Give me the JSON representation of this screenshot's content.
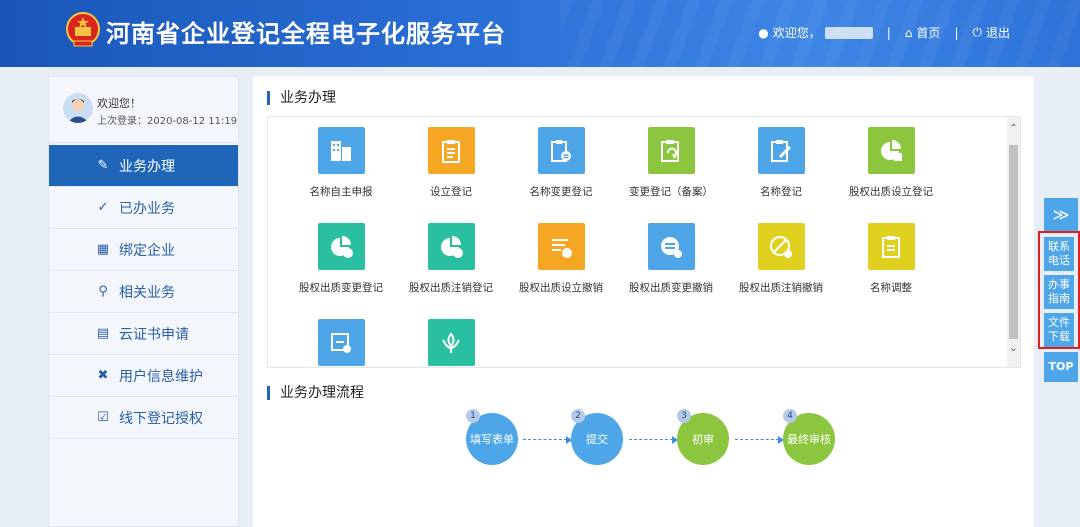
{
  "header": {
    "title": "河南省企业登记全程电子化服务平台",
    "welcome": "欢迎您，",
    "home": "首页",
    "logout": "退出",
    "divider": "|"
  },
  "sidebar": {
    "greeting": "欢迎您！",
    "last_login": "上次登录：2020-08-12 11:19",
    "items": [
      {
        "label": "业务办理",
        "icon": "doc-edit-icon"
      },
      {
        "label": "已办业务",
        "icon": "doc-check-icon"
      },
      {
        "label": "绑定企业",
        "icon": "building-icon"
      },
      {
        "label": "相关业务",
        "icon": "doc-search-icon"
      },
      {
        "label": "云证书申请",
        "icon": "certificate-icon"
      },
      {
        "label": "用户信息维护",
        "icon": "tools-icon"
      },
      {
        "label": "线下登记授权",
        "icon": "authorize-icon"
      }
    ]
  },
  "main": {
    "section1_title": "业务办理",
    "section2_title": "业务办理流程",
    "tiles": [
      {
        "label": "名称自主申报",
        "color": "#4ea6e8"
      },
      {
        "label": "设立登记",
        "color": "#f5a623"
      },
      {
        "label": "名称变更登记",
        "color": "#4ea6e8"
      },
      {
        "label": "变更登记（备案）",
        "color": "#8cc63f"
      },
      {
        "label": "名称登记",
        "color": "#4ea6e8"
      },
      {
        "label": "股权出质设立登记",
        "color": "#8cc63f"
      },
      {
        "label": "股权出质变更登记",
        "color": "#2bbfa2"
      },
      {
        "label": "股权出质注销登记",
        "color": "#2bbfa2"
      },
      {
        "label": "股权出质设立撤销",
        "color": "#f5a623"
      },
      {
        "label": "股权出质变更撤销",
        "color": "#4ea6e8"
      },
      {
        "label": "股权出质注销撤销",
        "color": "#e0d020"
      },
      {
        "label": "名称调整",
        "color": "#e0d020"
      },
      {
        "label": "",
        "color": "#4ea6e8"
      },
      {
        "label": "",
        "color": "#2bbfa2"
      }
    ],
    "steps": [
      {
        "num": "1",
        "label": "填写表单",
        "color": "#4ea6e8"
      },
      {
        "num": "2",
        "label": "提交",
        "color": "#4ea6e8"
      },
      {
        "num": "3",
        "label": "初审",
        "color": "#8cc63f"
      },
      {
        "num": "4",
        "label": "最终审核",
        "color": "#8cc63f"
      }
    ]
  },
  "float": {
    "expand": "≫",
    "contact": "联系电话",
    "guide": "办事指南",
    "download": "文件下载",
    "top": "TOP"
  }
}
